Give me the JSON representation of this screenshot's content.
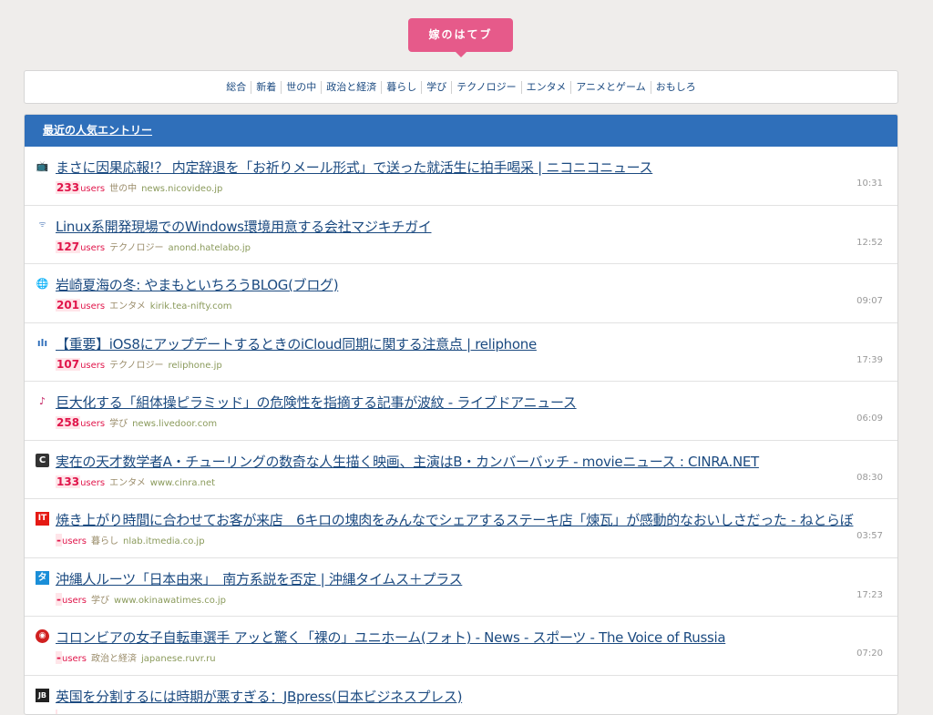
{
  "site": {
    "logo_text": "嫁のはてブ"
  },
  "nav": [
    {
      "label": "総合"
    },
    {
      "label": "新着"
    },
    {
      "label": "世の中"
    },
    {
      "label": "政治と経済"
    },
    {
      "label": "暮らし"
    },
    {
      "label": "学び"
    },
    {
      "label": "テクノロジー"
    },
    {
      "label": "エンタメ"
    },
    {
      "label": "アニメとゲーム"
    },
    {
      "label": "おもしろ"
    }
  ],
  "panel": {
    "title": "最近の人気エントリー"
  },
  "entries": [
    {
      "icon": "tv-icon",
      "glyph": "📺",
      "title": "まさに因果応報!？ 内定辞退を「お祈りメール形式」で送った就活生に拍手喝采 | ニコニコニュース",
      "users_count": "233",
      "users_label": "users",
      "category": "世の中",
      "domain": "news.nicovideo.jp",
      "time": "10:31"
    },
    {
      "icon": "hatena-icon",
      "glyph": "ᯤ",
      "title": "Linux系開発現場でのWindows環境用意する会社マジキチガイ",
      "users_count": "127",
      "users_label": "users",
      "category": "テクノロジー",
      "domain": "anond.hatelabo.jp",
      "time": "12:52"
    },
    {
      "icon": "globe-icon",
      "glyph": "🌐",
      "title": "岩崎夏海の冬: やまもといちろうBLOG(ブログ)",
      "users_count": "201",
      "users_label": "users",
      "category": "エンタメ",
      "domain": "kirik.tea-nifty.com",
      "time": "09:07"
    },
    {
      "icon": "waveform-icon",
      "glyph": "ılı",
      "title": "【重要】iOS8にアップデートするときのiCloud同期に関する注意点 | reliphone",
      "users_count": "107",
      "users_label": "users",
      "category": "テクノロジー",
      "domain": "reliphone.jp",
      "time": "17:39"
    },
    {
      "icon": "music-note-icon",
      "glyph": "♪",
      "title": "巨大化する「組体操ピラミッド」の危険性を指摘する記事が波紋 - ライブドアニュース",
      "users_count": "258",
      "users_label": "users",
      "category": "学び",
      "domain": "news.livedoor.com",
      "time": "06:09"
    },
    {
      "icon": "cinra-icon",
      "glyph": "C",
      "title": "実在の天才数学者A・チューリングの数奇な人生描く映画、主演はB・カンバーバッチ - movieニュース : CINRA.NET",
      "users_count": "133",
      "users_label": "users",
      "category": "エンタメ",
      "domain": "www.cinra.net",
      "time": "08:30"
    },
    {
      "icon": "itmedia-icon",
      "glyph": "IT",
      "title": "焼き上がり時間に合わせてお客が来店　6キロの塊肉をみんなでシェアするステーキ店「煉瓦」が感動的なおいしさだった - ねとらぼ",
      "users_count": "-",
      "users_label": "users",
      "category": "暮らし",
      "domain": "nlab.itmedia.co.jp",
      "time": "03:57"
    },
    {
      "icon": "okinawa-times-icon",
      "glyph": "タ",
      "title": "沖縄人ルーツ「日本由来」　南方系説を否定 | 沖縄タイムス＋プラス",
      "users_count": "-",
      "users_label": "users",
      "category": "学び",
      "domain": "www.okinawatimes.co.jp",
      "time": "17:23"
    },
    {
      "icon": "voice-of-russia-icon",
      "glyph": "◉",
      "title": "コロンビアの女子自転車選手 アッと驚く「裸の」ユニホーム(フォト) - News - スポーツ - The Voice of Russia",
      "users_count": "-",
      "users_label": "users",
      "category": "政治と経済",
      "domain": "japanese.ruvr.ru",
      "time": "07:20"
    },
    {
      "icon": "jbpress-icon",
      "glyph": "JB",
      "title": "英国を分割するには時期が悪すぎる：JBpress(日本ビジネスプレス)",
      "users_count": "",
      "users_label": "",
      "category": "",
      "domain": "",
      "time": ""
    }
  ]
}
